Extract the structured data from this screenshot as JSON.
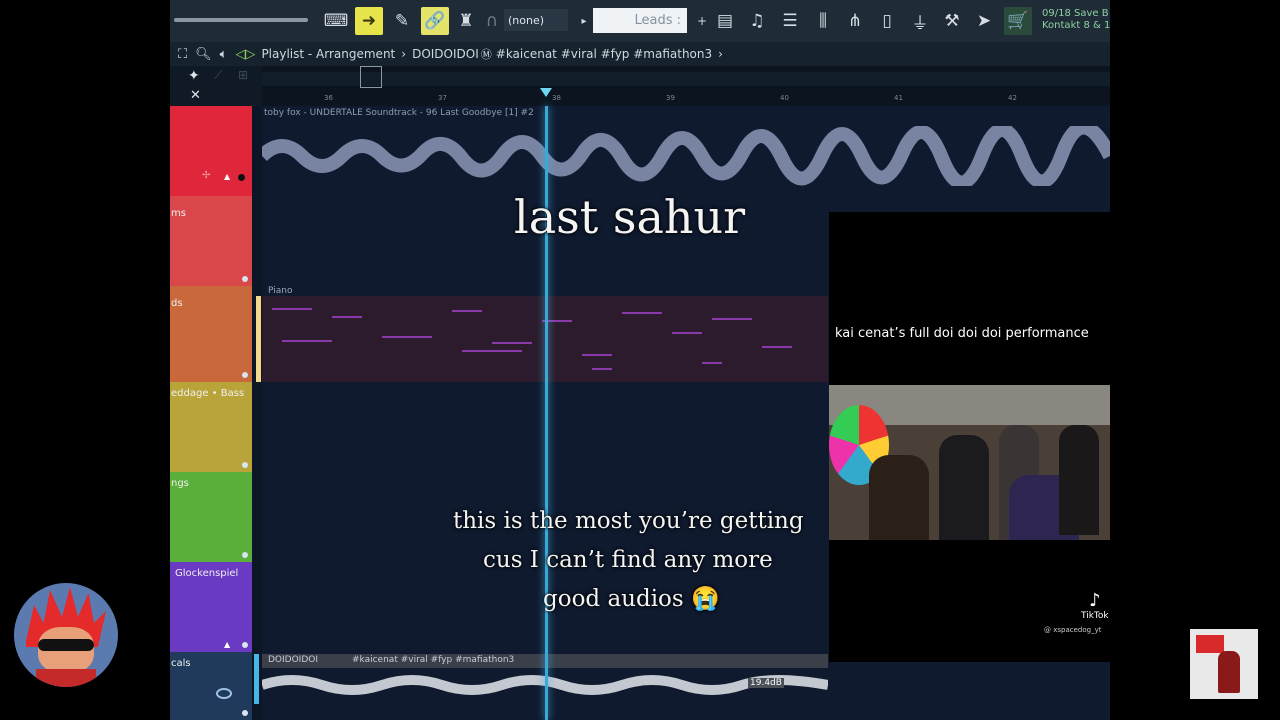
{
  "toolbar": {
    "pattern_select": "(none)",
    "leads_box": "Leads",
    "info_line1": "09/18  Save B",
    "info_line2": "Kontakt 8 & 1"
  },
  "titlebar": {
    "title": "Playlist - Arrangement",
    "path": "DOIDOIDOI",
    "tags": "#kaicenat #viral #fyp #mafiathon3"
  },
  "ruler": {
    "bars": [
      "36",
      "37",
      "38",
      "39",
      "40",
      "41",
      "42"
    ]
  },
  "tracks": [
    {
      "name": "",
      "color": "#e0263a"
    },
    {
      "name": "ms",
      "color": "#d9474a"
    },
    {
      "name": "ds",
      "color": "#c9683a"
    },
    {
      "name": "eddage • Bass",
      "color": "#b9a43a"
    },
    {
      "name": "ngs",
      "color": "#5aae3a"
    },
    {
      "name": "Glockenspiel",
      "color": "#6a3ac2"
    },
    {
      "name": "cals",
      "color": "#1f3a5a"
    }
  ],
  "clips": {
    "audio_top": "toby fox - UNDERTALE Soundtrack - 96 Last Goodbye [1] #2",
    "piano": "Piano",
    "vocals": "DOIDOIDOI",
    "vocals_tags": "#kaicenat #viral #fyp #mafiathon3",
    "vocals_db": "19.4dB"
  },
  "captions": {
    "title": "last sahur",
    "line1": "this is the most you’re getting",
    "line2": "cus I can’t find any more",
    "line3": "good audios 😭"
  },
  "tiktok": {
    "title": "kai cenat’s full doi doi doi performance",
    "logo": "TikTok",
    "handle": "@ xspacedog_yt"
  },
  "icons": [
    "piano-icon",
    "arrow-right-icon",
    "brush-icon",
    "link-icon",
    "stamp-icon",
    "magnet-icon",
    "playlist-icon",
    "mixer-icon",
    "channel-rack-icon",
    "plugin-icon",
    "browser-icon",
    "zoom-icon",
    "speaker-icon"
  ]
}
